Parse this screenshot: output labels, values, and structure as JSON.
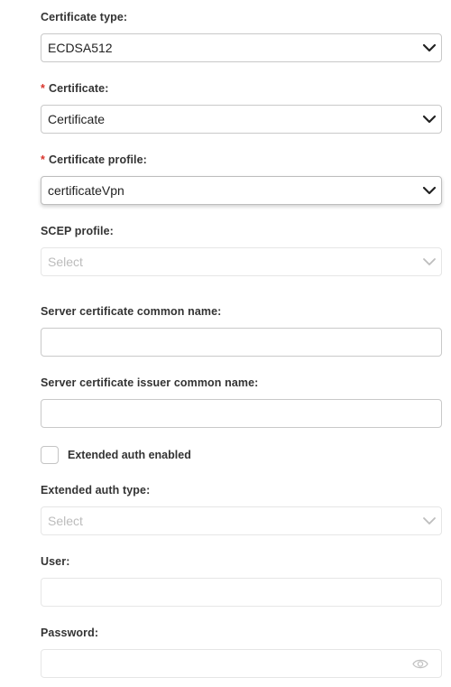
{
  "certificate_type": {
    "label": "Certificate type:",
    "value": "ECDSA512"
  },
  "certificate": {
    "required_mark": "*",
    "label": "Certificate:",
    "value": "Certificate"
  },
  "certificate_profile": {
    "required_mark": "*",
    "label": "Certificate profile:",
    "value": "certificateVpn"
  },
  "scep_profile": {
    "label": "SCEP profile:",
    "placeholder": "Select"
  },
  "server_cert_common_name": {
    "label": "Server certificate common name:",
    "value": ""
  },
  "server_cert_issuer_common_name": {
    "label": "Server certificate issuer common name:",
    "value": ""
  },
  "extended_auth_enabled": {
    "label": "Extended auth enabled",
    "checked": false
  },
  "extended_auth_type": {
    "label": "Extended auth type:",
    "placeholder": "Select"
  },
  "user": {
    "label": "User:",
    "value": ""
  },
  "password": {
    "label": "Password:",
    "value": ""
  },
  "colors": {
    "required": "#d9342b",
    "border": "#c9c9c9",
    "disabled_border": "#e6e6e6",
    "placeholder": "#bcbcbc"
  }
}
